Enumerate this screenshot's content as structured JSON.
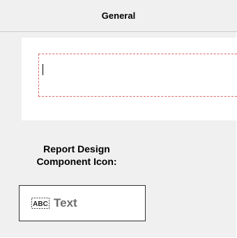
{
  "header": {
    "title": "General"
  },
  "preview": {
    "text_value": ""
  },
  "caption": {
    "line1": "Report Design",
    "line2": "Component Icon:"
  },
  "component": {
    "icon_name": "abc-text-icon",
    "label": "Text"
  },
  "colors": {
    "panel_bg": "#f0f0f0",
    "dashed_border": "#e06666",
    "label_gray": "#6d6d6d"
  }
}
